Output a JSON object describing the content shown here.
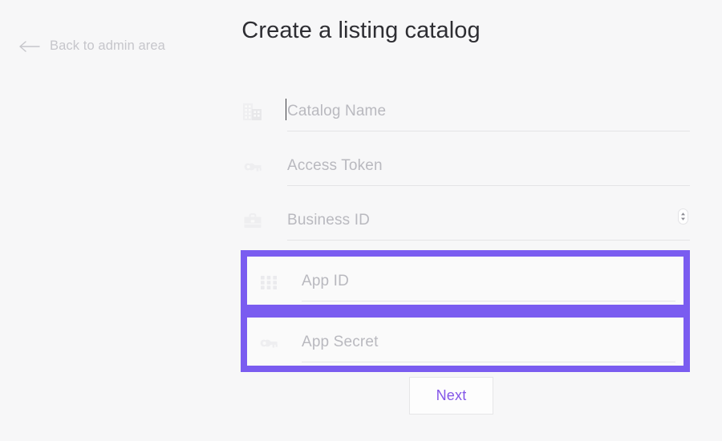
{
  "page": {
    "title": "Create a listing catalog",
    "background_color": "#f7f7f8",
    "accent_color": "#7a5cf0"
  },
  "back_link": {
    "label": "Back to admin area",
    "icon": "arrow-left-icon"
  },
  "form": {
    "fields": [
      {
        "name": "catalog-name",
        "placeholder": "Catalog Name",
        "icon": "building-icon",
        "value": "",
        "focused": true,
        "highlighted": false,
        "spinner": false
      },
      {
        "name": "access-token",
        "placeholder": "Access Token",
        "icon": "key-icon",
        "value": "",
        "focused": false,
        "highlighted": false,
        "spinner": false
      },
      {
        "name": "business-id",
        "placeholder": "Business ID",
        "icon": "briefcase-icon",
        "value": "",
        "focused": false,
        "highlighted": false,
        "spinner": true
      },
      {
        "name": "app-id",
        "placeholder": "App ID",
        "icon": "grid-dots-icon",
        "value": "",
        "focused": false,
        "highlighted": true,
        "spinner": false
      },
      {
        "name": "app-secret",
        "placeholder": "App Secret",
        "icon": "key-icon",
        "value": "",
        "focused": false,
        "highlighted": true,
        "spinner": false
      }
    ]
  },
  "submit": {
    "label": "Next"
  }
}
